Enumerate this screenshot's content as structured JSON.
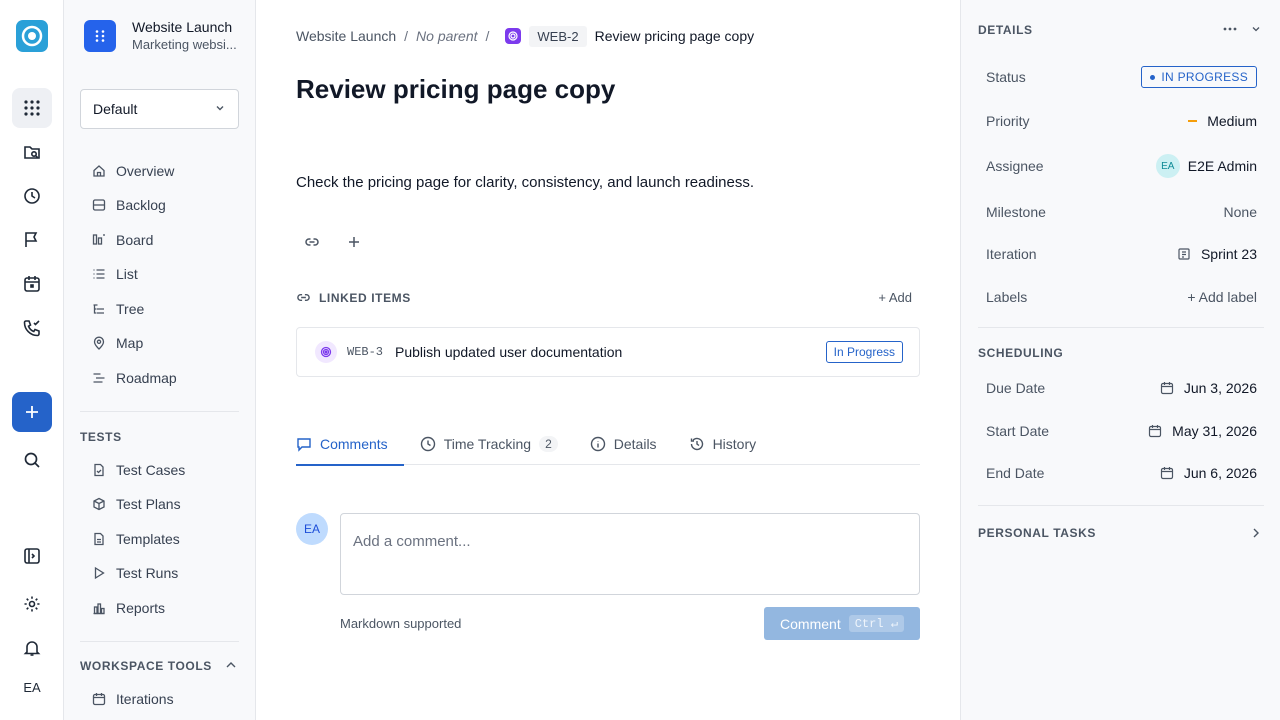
{
  "rail": {
    "avatar": "EA"
  },
  "project": {
    "name": "Website Launch",
    "subtitle": "Marketing websi..."
  },
  "view_select": {
    "value": "Default"
  },
  "nav": {
    "items": [
      {
        "label": "Overview",
        "icon": "home-icon"
      },
      {
        "label": "Backlog",
        "icon": "backlog-icon"
      },
      {
        "label": "Board",
        "icon": "board-icon"
      },
      {
        "label": "List",
        "icon": "list-icon"
      },
      {
        "label": "Tree",
        "icon": "tree-icon"
      },
      {
        "label": "Map",
        "icon": "map-pin-icon"
      },
      {
        "label": "Roadmap",
        "icon": "roadmap-icon"
      }
    ],
    "tests_title": "TESTS",
    "tests": [
      {
        "label": "Test Cases",
        "icon": "file-check-icon"
      },
      {
        "label": "Test Plans",
        "icon": "package-icon"
      },
      {
        "label": "Templates",
        "icon": "file-icon"
      },
      {
        "label": "Test Runs",
        "icon": "play-icon"
      },
      {
        "label": "Reports",
        "icon": "bar-chart-icon"
      }
    ],
    "workspace_title": "WORKSPACE TOOLS",
    "workspace": [
      {
        "label": "Iterations",
        "icon": "calendar-icon"
      }
    ]
  },
  "breadcrumb": {
    "root": "Website Launch",
    "sep": "/",
    "parent": "No parent",
    "key": "WEB-2",
    "title": "Review pricing page copy"
  },
  "issue": {
    "title": "Review pricing page copy",
    "description": "Check the pricing page for clarity, consistency, and launch readiness."
  },
  "linked": {
    "label": "LINKED ITEMS",
    "add": "+ Add",
    "items": [
      {
        "key": "WEB-3",
        "title": "Publish updated user documentation",
        "status": "In Progress"
      }
    ]
  },
  "tabs": [
    {
      "label": "Comments"
    },
    {
      "label": "Time Tracking",
      "count": "2"
    },
    {
      "label": "Details"
    },
    {
      "label": "History"
    }
  ],
  "comment": {
    "avatar": "EA",
    "placeholder": "Add a comment...",
    "note": "Markdown supported",
    "button": "Comment",
    "shortcut": "Ctrl ↵"
  },
  "details": {
    "title": "DETAILS",
    "status_label": "Status",
    "status_value": "IN PROGRESS",
    "priority_label": "Priority",
    "priority_value": "Medium",
    "assignee_label": "Assignee",
    "assignee_initials": "EA",
    "assignee_value": "E2E Admin",
    "milestone_label": "Milestone",
    "milestone_value": "None",
    "iteration_label": "Iteration",
    "iteration_value": "Sprint 23",
    "labels_label": "Labels",
    "labels_value": "+ Add label"
  },
  "scheduling": {
    "title": "SCHEDULING",
    "due_label": "Due Date",
    "due_value": "Jun 3, 2026",
    "start_label": "Start Date",
    "start_value": "May 31, 2026",
    "end_label": "End Date",
    "end_value": "Jun 6, 2026"
  },
  "personal_tasks": {
    "title": "PERSONAL TASKS"
  },
  "colors": {
    "accent": "#2563c9",
    "brand": "#2aa0d8",
    "priority_medium": "#f59e0b",
    "issue_type": "#7c3aed"
  }
}
